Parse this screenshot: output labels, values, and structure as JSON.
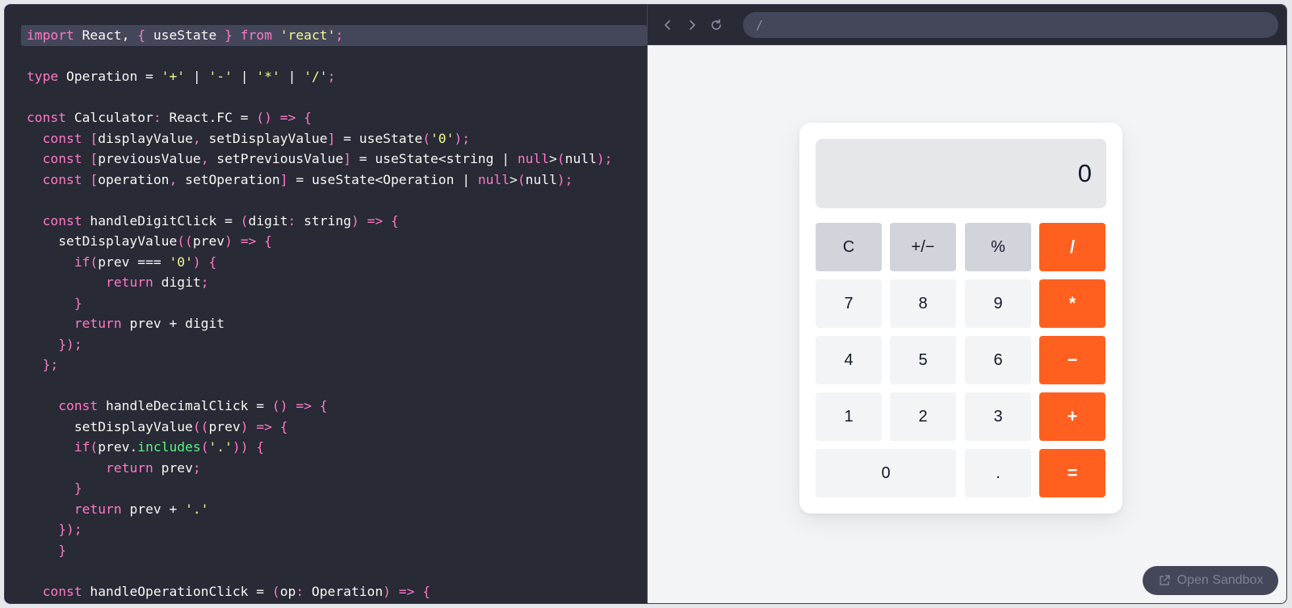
{
  "editor": {
    "lines": [
      [
        [
          "kw",
          "import"
        ],
        [
          "pl",
          " React, "
        ],
        [
          "kw",
          "{"
        ],
        [
          "pl",
          " useState "
        ],
        [
          "kw",
          "}"
        ],
        [
          "pl",
          " "
        ],
        [
          "kw",
          "from"
        ],
        [
          "pl",
          " "
        ],
        [
          "st",
          "'react'"
        ],
        [
          "kw",
          ";"
        ]
      ],
      [],
      [
        [
          "kw",
          "type"
        ],
        [
          "pl",
          " Operation = "
        ],
        [
          "st",
          "'+'"
        ],
        [
          "pl",
          " | "
        ],
        [
          "st",
          "'-'"
        ],
        [
          "pl",
          " | "
        ],
        [
          "st",
          "'*'"
        ],
        [
          "pl",
          " | "
        ],
        [
          "st",
          "'/'"
        ],
        [
          "kw",
          ";"
        ]
      ],
      [],
      [
        [
          "kw",
          "const"
        ],
        [
          "pl",
          " Calculator"
        ],
        [
          "kw",
          ":"
        ],
        [
          "pl",
          " React.FC = "
        ],
        [
          "kw",
          "()"
        ],
        [
          "pl",
          " "
        ],
        [
          "kw",
          "=>"
        ],
        [
          "pl",
          " "
        ],
        [
          "kw",
          "{"
        ]
      ],
      [
        [
          "pl",
          "  "
        ],
        [
          "kw",
          "const"
        ],
        [
          "pl",
          " "
        ],
        [
          "kw",
          "["
        ],
        [
          "pl",
          "displayValue"
        ],
        [
          "kw",
          ","
        ],
        [
          "pl",
          " setDisplayValue"
        ],
        [
          "kw",
          "]"
        ],
        [
          "pl",
          " = useState"
        ],
        [
          "kw",
          "("
        ],
        [
          "st",
          "'0'"
        ],
        [
          "kw",
          ");"
        ]
      ],
      [
        [
          "pl",
          "  "
        ],
        [
          "kw",
          "const"
        ],
        [
          "pl",
          " "
        ],
        [
          "kw",
          "["
        ],
        [
          "pl",
          "previousValue"
        ],
        [
          "kw",
          ","
        ],
        [
          "pl",
          " setPreviousValue"
        ],
        [
          "kw",
          "]"
        ],
        [
          "pl",
          " = useState<string | "
        ],
        [
          "kw",
          "null"
        ],
        [
          "pl",
          ">"
        ],
        [
          "kw",
          "("
        ],
        [
          "pl",
          "null"
        ],
        [
          "kw",
          ");"
        ]
      ],
      [
        [
          "pl",
          "  "
        ],
        [
          "kw",
          "const"
        ],
        [
          "pl",
          " "
        ],
        [
          "kw",
          "["
        ],
        [
          "pl",
          "operation"
        ],
        [
          "kw",
          ","
        ],
        [
          "pl",
          " setOperation"
        ],
        [
          "kw",
          "]"
        ],
        [
          "pl",
          " = useState<Operation | "
        ],
        [
          "kw",
          "null"
        ],
        [
          "pl",
          ">"
        ],
        [
          "kw",
          "("
        ],
        [
          "pl",
          "null"
        ],
        [
          "kw",
          ");"
        ]
      ],
      [],
      [
        [
          "pl",
          "  "
        ],
        [
          "kw",
          "const"
        ],
        [
          "pl",
          " handleDigitClick = "
        ],
        [
          "kw",
          "("
        ],
        [
          "pl",
          "digit"
        ],
        [
          "kw",
          ":"
        ],
        [
          "pl",
          " string"
        ],
        [
          "kw",
          ")"
        ],
        [
          "pl",
          " "
        ],
        [
          "kw",
          "=>"
        ],
        [
          "pl",
          " "
        ],
        [
          "kw",
          "{"
        ]
      ],
      [
        [
          "pl",
          "    setDisplayValue"
        ],
        [
          "kw",
          "(("
        ],
        [
          "pl",
          "prev"
        ],
        [
          "kw",
          ")"
        ],
        [
          "pl",
          " "
        ],
        [
          "kw",
          "=>"
        ],
        [
          "pl",
          " "
        ],
        [
          "kw",
          "{"
        ]
      ],
      [
        [
          "pl",
          "      "
        ],
        [
          "kw",
          "if("
        ],
        [
          "pl",
          "prev === "
        ],
        [
          "st",
          "'0'"
        ],
        [
          "kw",
          ")"
        ],
        [
          "pl",
          " "
        ],
        [
          "kw",
          "{"
        ]
      ],
      [
        [
          "pl",
          "          "
        ],
        [
          "kw",
          "return"
        ],
        [
          "pl",
          " digit"
        ],
        [
          "kw",
          ";"
        ]
      ],
      [
        [
          "pl",
          "      "
        ],
        [
          "kw",
          "}"
        ]
      ],
      [
        [
          "pl",
          "      "
        ],
        [
          "kw",
          "return"
        ],
        [
          "pl",
          " prev + digit"
        ]
      ],
      [
        [
          "pl",
          "    "
        ],
        [
          "kw",
          "});"
        ]
      ],
      [
        [
          "pl",
          "  "
        ],
        [
          "kw",
          "};"
        ]
      ],
      [],
      [
        [
          "pl",
          "    "
        ],
        [
          "kw",
          "const"
        ],
        [
          "pl",
          " handleDecimalClick = "
        ],
        [
          "kw",
          "()"
        ],
        [
          "pl",
          " "
        ],
        [
          "kw",
          "=>"
        ],
        [
          "pl",
          " "
        ],
        [
          "kw",
          "{"
        ]
      ],
      [
        [
          "pl",
          "      setDisplayValue"
        ],
        [
          "kw",
          "(("
        ],
        [
          "pl",
          "prev"
        ],
        [
          "kw",
          ")"
        ],
        [
          "pl",
          " "
        ],
        [
          "kw",
          "=>"
        ],
        [
          "pl",
          " "
        ],
        [
          "kw",
          "{"
        ]
      ],
      [
        [
          "pl",
          "      "
        ],
        [
          "kw",
          "if("
        ],
        [
          "pl",
          "prev."
        ],
        [
          "fn",
          "includes"
        ],
        [
          "kw",
          "("
        ],
        [
          "st",
          "'.'"
        ],
        [
          "kw",
          "))"
        ],
        [
          "pl",
          " "
        ],
        [
          "kw",
          "{"
        ]
      ],
      [
        [
          "pl",
          "          "
        ],
        [
          "kw",
          "return"
        ],
        [
          "pl",
          " prev"
        ],
        [
          "kw",
          ";"
        ]
      ],
      [
        [
          "pl",
          "      "
        ],
        [
          "kw",
          "}"
        ]
      ],
      [
        [
          "pl",
          "      "
        ],
        [
          "kw",
          "return"
        ],
        [
          "pl",
          " prev + "
        ],
        [
          "st",
          "'.'"
        ]
      ],
      [
        [
          "pl",
          "    "
        ],
        [
          "kw",
          "});"
        ]
      ],
      [
        [
          "pl",
          "    "
        ],
        [
          "kw",
          "}"
        ]
      ],
      [],
      [
        [
          "pl",
          "  "
        ],
        [
          "kw",
          "const"
        ],
        [
          "pl",
          " handleOperationClick = "
        ],
        [
          "kw",
          "("
        ],
        [
          "pl",
          "op"
        ],
        [
          "kw",
          ":"
        ],
        [
          "pl",
          " Operation"
        ],
        [
          "kw",
          ")"
        ],
        [
          "pl",
          " "
        ],
        [
          "kw",
          "=>"
        ],
        [
          "pl",
          " "
        ],
        [
          "kw",
          "{"
        ]
      ]
    ]
  },
  "browser": {
    "back_icon": "chevron-left-icon",
    "forward_icon": "chevron-right-icon",
    "refresh_icon": "refresh-icon",
    "url": "/"
  },
  "calculator": {
    "display_value": "0",
    "buttons": [
      {
        "label": "C",
        "kind": "fn",
        "col": 0,
        "row": 0
      },
      {
        "label": "+/−",
        "kind": "fn",
        "col": 1,
        "row": 0
      },
      {
        "label": "%",
        "kind": "fn",
        "col": 2,
        "row": 0
      },
      {
        "label": "/",
        "kind": "op",
        "col": 3,
        "row": 0
      },
      {
        "label": "7",
        "kind": "num",
        "col": 0,
        "row": 1
      },
      {
        "label": "8",
        "kind": "num",
        "col": 1,
        "row": 1
      },
      {
        "label": "9",
        "kind": "num",
        "col": 2,
        "row": 1
      },
      {
        "label": "*",
        "kind": "op",
        "col": 3,
        "row": 1
      },
      {
        "label": "4",
        "kind": "num",
        "col": 0,
        "row": 2
      },
      {
        "label": "5",
        "kind": "num",
        "col": 1,
        "row": 2
      },
      {
        "label": "6",
        "kind": "num",
        "col": 2,
        "row": 2
      },
      {
        "label": "−",
        "kind": "op",
        "col": 3,
        "row": 2
      },
      {
        "label": "1",
        "kind": "num",
        "col": 0,
        "row": 3
      },
      {
        "label": "2",
        "kind": "num",
        "col": 1,
        "row": 3
      },
      {
        "label": "3",
        "kind": "num",
        "col": 2,
        "row": 3
      },
      {
        "label": "+",
        "kind": "op",
        "col": 3,
        "row": 3
      },
      {
        "label": "0",
        "kind": "num",
        "col": 0,
        "row": 4,
        "wide": true
      },
      {
        "label": ".",
        "kind": "num",
        "col": 2,
        "row": 4
      },
      {
        "label": "=",
        "kind": "op",
        "col": 3,
        "row": 4
      }
    ]
  },
  "sandbox": {
    "label": "Open Sandbox",
    "icon": "external-link-icon"
  },
  "colors": {
    "accent": "#ff5f1f",
    "editor_bg": "#282a36",
    "keyword": "#ff79c6",
    "string": "#f1fa8c",
    "function": "#50fa7b"
  }
}
